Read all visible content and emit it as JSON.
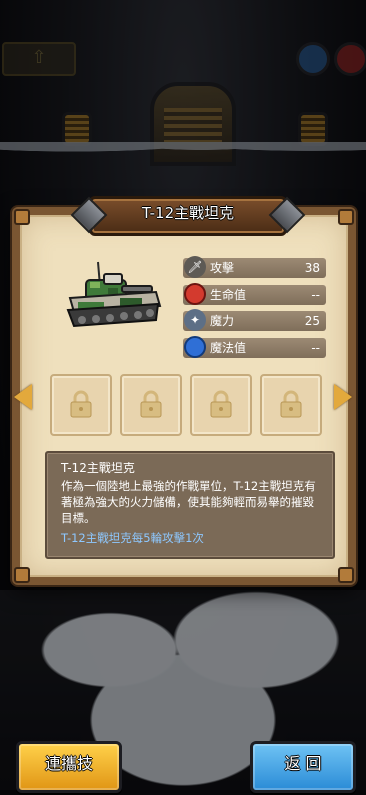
{
  "dialog": {
    "title": "T-12主戰坦克",
    "unit_image": "tank-icon"
  },
  "stats": [
    {
      "icon": "sword-icon",
      "label": "攻擊",
      "value": "38",
      "color": "#d9d0c4"
    },
    {
      "icon": "red-potion-icon",
      "label": "生命值",
      "value": "--",
      "color": "#d33a2e"
    },
    {
      "icon": "wand-icon",
      "label": "魔力",
      "value": "25",
      "color": "#4a9fe0"
    },
    {
      "icon": "blue-potion-icon",
      "label": "魔法值",
      "value": "--",
      "color": "#2f6fd6"
    }
  ],
  "slots": [
    {
      "state": "locked",
      "icon": "lock-icon"
    },
    {
      "state": "locked",
      "icon": "lock-icon"
    },
    {
      "state": "locked",
      "icon": "lock-icon"
    },
    {
      "state": "locked",
      "icon": "lock-icon"
    }
  ],
  "description": {
    "title": "T-12主戰坦克",
    "body": "作為一個陸地上最強的作戰單位，T-12主戰坦克有著極為強大的火力儲備，使其能夠輕而易舉的摧毀目標。",
    "note": "T-12主戰坦克每5輪攻擊1次"
  },
  "buttons": {
    "combo": "連攜技",
    "back": "返 回"
  },
  "colors": {
    "accent_gold": "#e09515",
    "accent_blue": "#2a8bd6",
    "note_blue": "#8ec8ff"
  }
}
